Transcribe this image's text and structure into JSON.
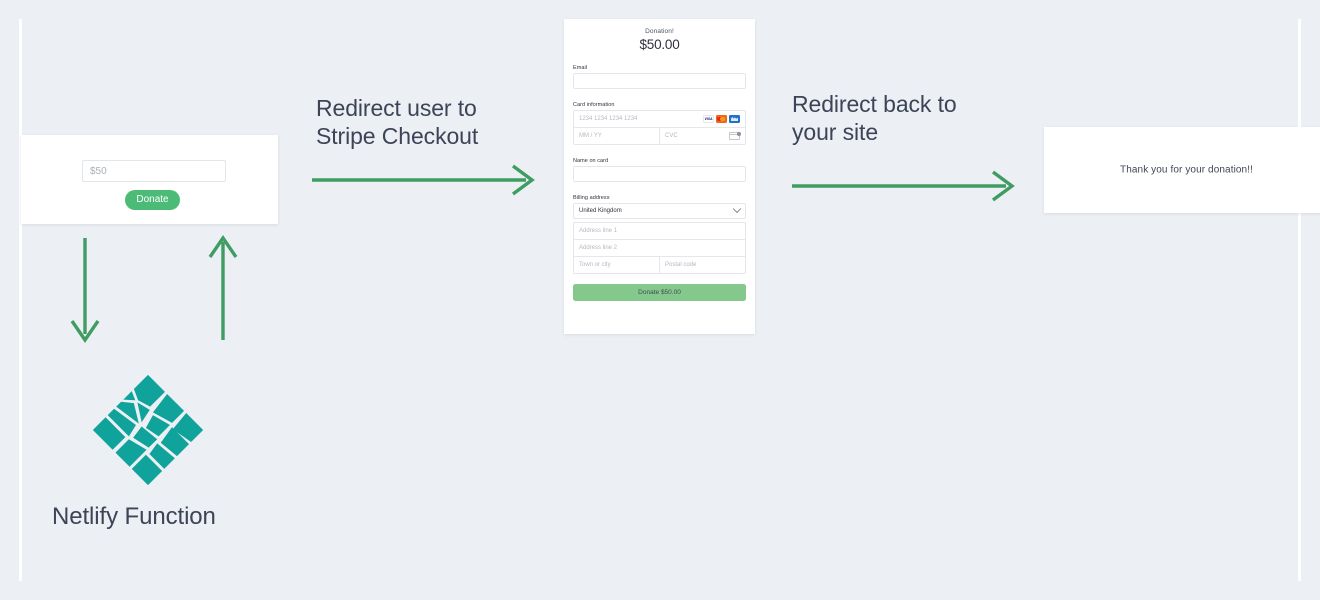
{
  "colors": {
    "background": "#ecf0f4",
    "arrow_green": "#3f9c62",
    "donate_button_green": "#4cbb77",
    "stripe_submit_green": "#84c98b",
    "netlify_teal": "#0fa39b",
    "text_dark": "#3d4457"
  },
  "donate_widget": {
    "amount_placeholder": "$50",
    "amount_value": "",
    "button_label": "Donate"
  },
  "stripe_checkout": {
    "title": "Donation!",
    "amount": "$50.00",
    "email_label": "Email",
    "email_value": "",
    "card_information_label": "Card information",
    "card_number_placeholder": "1234 1234 1234 1234",
    "expiry_placeholder": "MM / YY",
    "cvc_placeholder": "CVC",
    "card_brands": [
      "visa-icon",
      "mastercard-icon",
      "amex-icon"
    ],
    "cvc_hint_icon": "cvc-card-icon",
    "name_on_card_label": "Name on card",
    "name_on_card_value": "",
    "billing_address_label": "Billing address",
    "country_value": "United Kingdom",
    "country_chevron_icon": "chevron-down-icon",
    "address_line_1_placeholder": "Address line 1",
    "address_line_2_placeholder": "Address line 2",
    "town_placeholder": "Town or city",
    "postal_placeholder": "Postal code",
    "submit_label": "Donate $50.00"
  },
  "thank_you": {
    "message": "Thank you for your donation!!"
  },
  "arrows": {
    "to_stripe_label": "Redirect user to\nStripe Checkout",
    "to_site_label": "Redirect back to\nyour site",
    "down_arrow_icon": "arrow-down-icon",
    "up_arrow_icon": "arrow-up-icon",
    "right_arrow_icon": "arrow-right-icon"
  },
  "netlify": {
    "caption": "Netlify Function",
    "logo_icon": "netlify-diamond-logo"
  }
}
